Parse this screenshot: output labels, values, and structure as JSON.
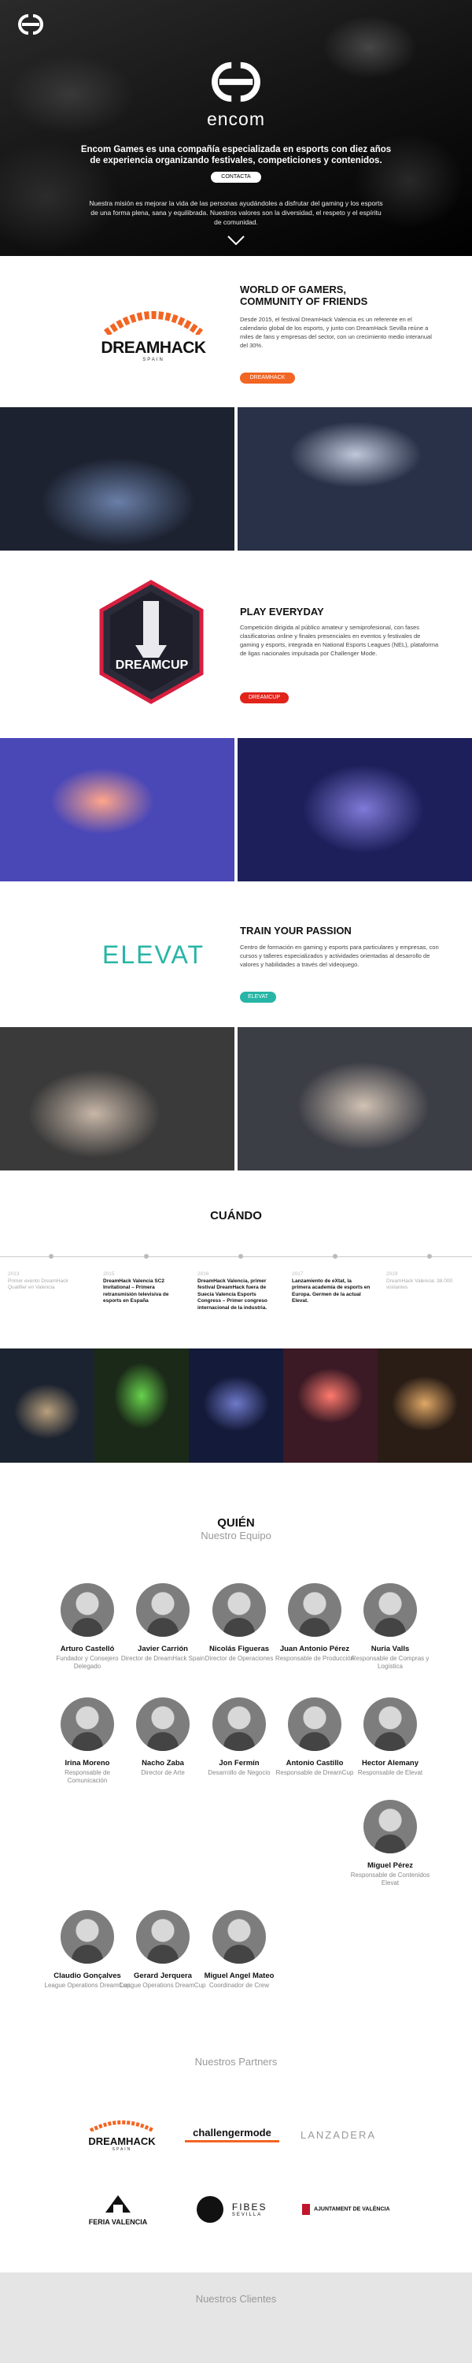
{
  "hero": {
    "brand": "encom",
    "lead": "Encom Games es una compañía especializada en esports con diez años de experiencia organizando festivales, competiciones y contenidos.",
    "contact_label": "CONTACTA",
    "mission": "Nuestra misión es mejorar la vida de las personas ayudándoles a disfrutar del gaming y los esports de una forma plena, sana y equilibrada. Nuestros valores son la diversidad, el respeto y el espíritu de comunidad."
  },
  "blocks": [
    {
      "logo_text": "DREAMHACK",
      "logo_sub": "SPAIN",
      "title": "WORLD OF GAMERS, COMMUNITY OF FRIENDS",
      "text": "Desde 2015, el festival DreamHack Valencia es un referente en el calendario global de los esports, y junto con DreamHack Sevilla reúne a miles de fans y empresas del sector, con un crecimiento medio interanual del 30%.",
      "button": "DREAMHACK",
      "color": "#f26522"
    },
    {
      "logo_text": "DREAMCUP",
      "title": "PLAY EVERYDAY",
      "text": "Competición dirigida al público amateur y semiprofesional, con fases clasificatorias online y finales presenciales en eventos y festivales de gaming y esports, integrada en National Esports Leagues (NEL), plataforma de ligas nacionales impulsada por Challenger Mode.",
      "button": "DREAMCUP",
      "color": "#e2231a"
    },
    {
      "logo_text": "ELEVAT",
      "title": "TRAIN YOUR PASSION",
      "text": "Centro de formación en gaming y esports para particulares y empresas, con cursos y talleres especializados y actividades orientadas al desarrollo de valores y habilidades a través del videojuego.",
      "button": "ELEVAT",
      "color": "#26b5a6"
    }
  ],
  "timeline": {
    "title": "CUÁNDO",
    "items": [
      {
        "year": "2013",
        "text": "Primer evento DreamHack Qualifier en Valencia",
        "strong": false
      },
      {
        "year": "2015",
        "text": "DreamHack Valencia SC2 Invitational – Primera retransmisión televisiva de esports en España",
        "strong": true
      },
      {
        "year": "2016",
        "text": "DreamHack Valencia, primer festival DreamHack fuera de Suecia Valencia Esports Congress – Primer congreso internacional de la industria.",
        "strong": true
      },
      {
        "year": "2017",
        "text": "Lanzamiento de eXtat, la primera academia de esports en Europa. Germen de la actual Elevat.",
        "strong": true
      },
      {
        "year": "2019",
        "text": "DreamHack Valencia: 38.000 visitantes",
        "strong": false
      }
    ]
  },
  "team": {
    "title": "QUIÉN",
    "subtitle": "Nuestro Equipo",
    "members": [
      {
        "name": "Arturo Castelló",
        "role": "Fundador y Consejero Delegado"
      },
      {
        "name": "Javier Carrión",
        "role": "Director de DreamHack Spain"
      },
      {
        "name": "Nicolás Figueras",
        "role": "Director de Operaciones"
      },
      {
        "name": "Juan Antonio Pérez",
        "role": "Responsable de Producción"
      },
      {
        "name": "Nuria Valls",
        "role": "Responsable de Compras y Logística"
      },
      {
        "name": "Irina Moreno",
        "role": "Responsable de Comunicación"
      },
      {
        "name": "Nacho Zaba",
        "role": "Director de Arte"
      },
      {
        "name": "Jon Fermín",
        "role": "Desarrollo de Negocio"
      },
      {
        "name": "Antonio Castillo",
        "role": "Responsable de DreamCup"
      },
      {
        "name": "Hector Alemany",
        "role": "Responsable de Elevat"
      },
      {
        "name": "Miguel Pérez",
        "role": "Responsable de Contenidos Elevat"
      },
      {
        "name": "Claudio Gonçalves",
        "role": "League Operations DreamCup"
      },
      {
        "name": "Gerard Jerquera",
        "role": "League Operations DreamCup"
      },
      {
        "name": "Miguel Angel Mateo",
        "role": "Coordinador de Crew"
      }
    ]
  },
  "partners": {
    "title": "Nuestros Partners",
    "items": [
      {
        "name": "DREAMHACK",
        "sub": "SPAIN"
      },
      {
        "name": "challengermode",
        "sub": ""
      },
      {
        "name": "LANZADERA",
        "sub": ""
      },
      {
        "name": "FERIA VALENCIA",
        "sub": ""
      },
      {
        "name": "FIBES",
        "sub": "SEVILLA"
      },
      {
        "name": "AJUNTAMENT DE VALÈNCIA",
        "sub": ""
      }
    ]
  },
  "clients": {
    "title": "Nuestros Clientes"
  }
}
